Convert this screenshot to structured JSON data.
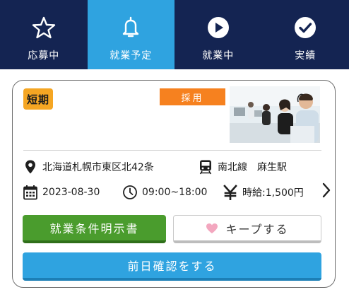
{
  "tabs": [
    {
      "label": "応募中",
      "icon": "star-icon"
    },
    {
      "label": "就業予定",
      "icon": "bell-icon"
    },
    {
      "label": "就業中",
      "icon": "play-circle-icon"
    },
    {
      "label": "実績",
      "icon": "check-circle-icon"
    }
  ],
  "active_tab": "就業予定",
  "colors": {
    "tabbar_bg": "#142452",
    "tab_active_bg": "#2fa3e0",
    "badge_short_bg": "#f5a623",
    "badge_hired_bg": "#f6811f",
    "terms_button_bg": "#4a9c2d",
    "confirm_button_bg": "#2fa3e0",
    "heart": "#f3a7bf"
  },
  "job": {
    "badge_short": "短期",
    "badge_hired": "採用",
    "photo_icon": "call-center-photo",
    "address": "北海道札幌市東区北42条",
    "station": "南北線　麻生駅",
    "date": "2023-08-30",
    "time": "09:00~18:00",
    "wage": "時給:1,500円"
  },
  "buttons": {
    "terms": "就業条件明示書",
    "keep": "キープする",
    "confirm": "前日確認をする"
  }
}
